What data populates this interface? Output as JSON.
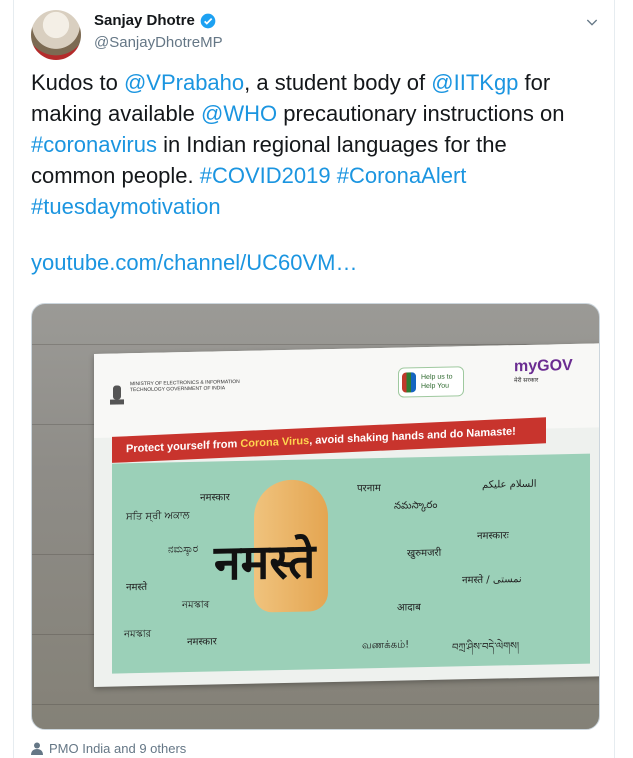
{
  "tweet": {
    "display_name": "Sanjay Dhotre",
    "handle": "@SanjayDhotreMP",
    "text_parts": [
      {
        "t": "Kudos to ",
        "link": false
      },
      {
        "t": "@VPrabaho",
        "link": true
      },
      {
        "t": ", a student body of ",
        "link": false
      },
      {
        "t": "@IITKgp",
        "link": true
      },
      {
        "t": " for making available ",
        "link": false
      },
      {
        "t": "@WHO",
        "link": true
      },
      {
        "t": " precautionary instructions on ",
        "link": false
      },
      {
        "t": "#coronavirus",
        "link": true
      },
      {
        "t": " in Indian regional languages for the common people. ",
        "link": false
      },
      {
        "t": "#COVID2019",
        "link": true
      },
      {
        "t": " ",
        "link": false
      },
      {
        "t": "#CoronaAlert",
        "link": true
      },
      {
        "t": " ",
        "link": false
      },
      {
        "t": "#tuesdaymotivation",
        "link": true
      }
    ],
    "url": "youtube.com/channel/UC60VM…",
    "footer": "PMO India and 9 others"
  },
  "poster": {
    "ministry": "MINISTRY OF ELECTRONICS & INFORMATION TECHNOLOGY GOVERNMENT OF INDIA",
    "helpus": "Help us to Help You",
    "mygov": "myGOV",
    "mygov_sub": "मेरी सरकार",
    "banner_pre": "Protect yourself from ",
    "banner_hl": "Corona Virus",
    "banner_post": ", avoid shaking hands and do Namaste!",
    "big_word": "नमस्ते",
    "words": [
      "नमस्कार",
      "परनाम",
      "السلام عليكم",
      "ਸਤਿ ਸ੍ਰੀ ਅਕਾਲ",
      "నమస్కారం",
      "नमस्कारः",
      "ನಮಸ್ಕಾರ",
      "खुरुमजरी",
      "नमस्ते",
      "नमस्ते / نمستی",
      "নমস্কাৰ",
      "आदाब",
      "নমস্কার",
      "नमस्कार",
      "வணக்கம்!",
      "བཀྲ་ཤིས་བདེ་ལེགས།"
    ]
  },
  "colors": {
    "link": "#1b95e0",
    "banner": "#c8342d",
    "panel": "#9bd0b8"
  }
}
